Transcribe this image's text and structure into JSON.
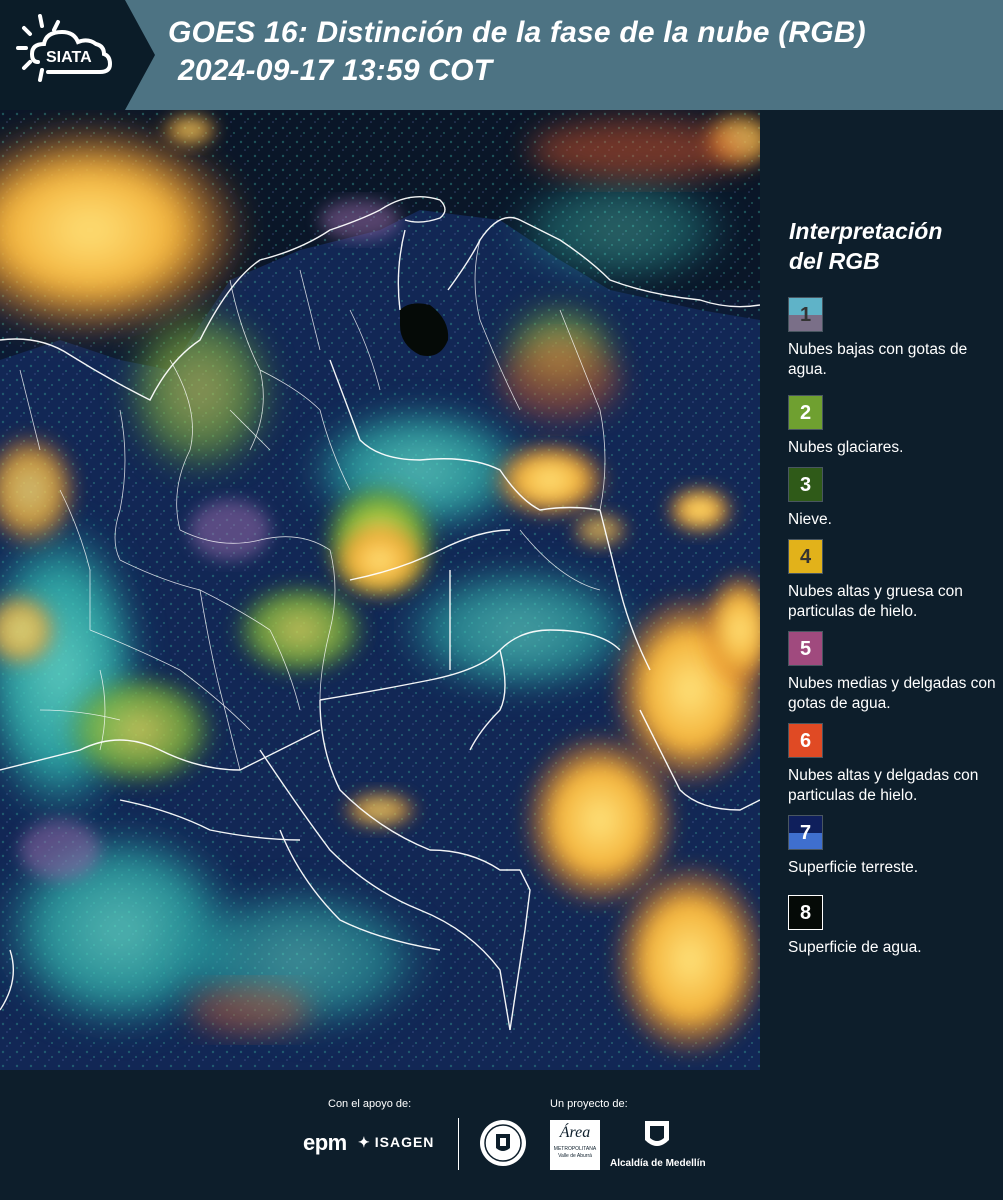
{
  "header": {
    "logo_text": "SIATA",
    "title_line1": "GOES 16: Distinción de la fase de la nube (RGB)",
    "title_line2": "2024-09-17 13:59 COT",
    "band_color": "#4d7383"
  },
  "map": {
    "description_icon": "satellite-rgb-map",
    "ocean_color": "#0c1a33",
    "border_color": "#ffffff"
  },
  "legend": {
    "title_line1": "Interpretación",
    "title_line2": "del RGB",
    "items": [
      {
        "number": "1",
        "label": "Nubes bajas con gotas de agua.",
        "colors": [
          "#5fb3c8",
          "#7a6f88"
        ],
        "num_color": "#333333"
      },
      {
        "number": "2",
        "label": "Nubes glaciares.",
        "colors": [
          "#6fa030"
        ],
        "num_color": "#ffffff"
      },
      {
        "number": "3",
        "label": "Nieve.",
        "colors": [
          "#2f5a18"
        ],
        "num_color": "#ffffff"
      },
      {
        "number": "4",
        "label": "Nubes altas y gruesa con particulas de hielo.",
        "colors": [
          "#e2b21a"
        ],
        "num_color": "#333333"
      },
      {
        "number": "5",
        "label": "Nubes medias y delgadas con gotas de agua.",
        "colors": [
          "#a04a7e"
        ],
        "num_color": "#ffffff"
      },
      {
        "number": "6",
        "label": "Nubes altas y delgadas con particulas de hielo.",
        "colors": [
          "#e04a24"
        ],
        "num_color": "#ffffff"
      },
      {
        "number": "7",
        "label": "Superficie terreste.",
        "colors": [
          "#0f1f5c",
          "#3f6fcf"
        ],
        "num_color": "#ffffff"
      },
      {
        "number": "8",
        "label": "Superficie de agua.",
        "colors": [
          "#050a07"
        ],
        "num_color": "#ffffff"
      }
    ]
  },
  "footer": {
    "support_label": "Con el apoyo de:",
    "project_label": "Un proyecto de:",
    "epm": "epm",
    "isagen": "ISAGEN",
    "area_text": "Área",
    "area_sub1": "METROPOLITANA",
    "area_sub2": "Valle de Aburrá",
    "alcaldia": "Alcaldía de Medellín"
  }
}
